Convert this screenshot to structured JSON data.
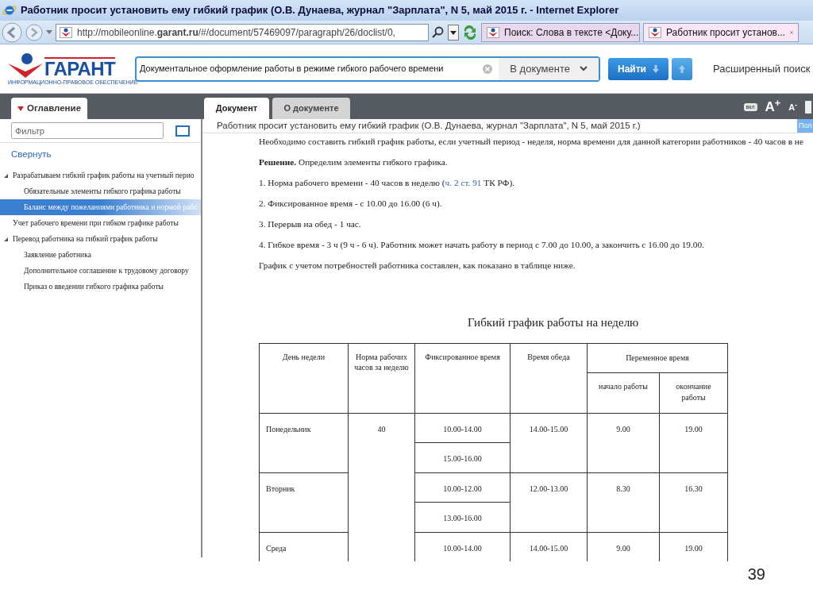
{
  "window": {
    "title": "Работник просит установить ему гибкий график (О.В. Дунаева, журнал \"Зарплата\", N 5, май 2015 г. - Internet Explorer"
  },
  "address_bar": {
    "url": "http://mobileonline.**garant.ru**/#/document/57469097/paragraph/26/doclist/0,"
  },
  "browser_tabs": [
    {
      "label": "Поиск: Слова в тексте <Доку...",
      "selected": false
    },
    {
      "label": "Работник просит установ...",
      "selected": true
    }
  ],
  "logo": {
    "name": "ГАРАНТ",
    "tagline": "ИНФОРМАЦИОННО-ПРАВОВОЕ ОБЕСПЕЧЕНИЕ"
  },
  "search": {
    "value": "Документальное оформление работы в режиме гибкого рабочего времени",
    "scope": "В документе",
    "button": "Найти",
    "advanced": "Расширенный поиск"
  },
  "toc": {
    "tab": "Оглавление",
    "filter_placeholder": "Фильтр",
    "collapse": "Свернуть",
    "items": [
      {
        "label": "Разрабатываем гибкий график работы на учетный перио",
        "expanded": true,
        "selected": false,
        "children": [
          {
            "label": "Обязательные элементы гибкого графика работы",
            "selected": false
          },
          {
            "label": "Баланс между пожеланиями работника и нормой рабо",
            "selected": true
          }
        ]
      },
      {
        "label": "Учет рабочего времени при гибком графике работы",
        "selected": false
      },
      {
        "label": "Перевод работника на гибкий график работы",
        "expanded": true,
        "selected": false,
        "children": [
          {
            "label": "Заявление работника",
            "selected": false
          },
          {
            "label": "Дополнительное соглашение к трудовому договору",
            "selected": false
          },
          {
            "label": "Приказ о введении гибкого графика работы",
            "selected": false
          }
        ]
      }
    ]
  },
  "doc_tabs": [
    {
      "label": "Документ",
      "selected": true
    },
    {
      "label": "О документе",
      "selected": false
    }
  ],
  "toolbar": {
    "toggle": "вкл",
    "font_larger": "A$^{+}$",
    "font_smaller": "A$^{-}$"
  },
  "document": {
    "title": "Работник просит установить ему гибкий график (О.В. Дунаева, журнал \"Зарплата\", N 5, май 2015 г.)",
    "side_button": "Пол",
    "paragraphs": [
      [
        {
          "kind": "text",
          "text": "Необходимо составить гибкий график работы, если учетный период - неделя, норма времени для данной категории работников - 40 часов в не"
        }
      ],
      [
        {
          "kind": "text",
          "text": "**Решение.** Определим элементы гибкого графика."
        }
      ],
      [
        {
          "kind": "text",
          "text": "1. Норма рабочего времени - 40 часов в неделю ("
        },
        {
          "kind": "link",
          "text": "ч. 2 ст. 91"
        },
        {
          "kind": "text",
          "text": " ТК РФ)."
        }
      ],
      [
        {
          "kind": "text",
          "text": "2. Фиксированное время - с 10.00 до 16.00 (6 ч)."
        }
      ],
      [
        {
          "kind": "text",
          "text": "3. Перерыв на обед - 1 час."
        }
      ],
      [
        {
          "kind": "text",
          "text": "4. Гибкое время - 3 ч (9 ч - 6 ч). Работник может начать работу в период с 7.00 до 10.00, а закончить с 16.00 до 19.00."
        }
      ],
      [
        {
          "kind": "text",
          "text": "График с учетом потребностей работника составлен, как показано в таблице ниже."
        }
      ]
    ],
    "table": {
      "title": "Гибкий график работы на неделю",
      "columns": [
        "День недели",
        "Норма рабочих часов за неделю",
        "Фиксированное время",
        "Время обеда"
      ],
      "group_column": "Переменное время",
      "sub_columns": [
        "начало работы",
        "окончание работы"
      ],
      "norm": "40",
      "rows": [
        {
          "day": "Понедельник",
          "fixed": [
            "10.00-14.00",
            "15.00-16.00"
          ],
          "lunch": "14.00-15.00",
          "start": "9.00",
          "end": "19.00"
        },
        {
          "day": "Вторник",
          "fixed": [
            "10.00-12.00",
            "13.00-16.00"
          ],
          "lunch": "12.00-13.00",
          "start": "8.30",
          "end": "16.30"
        },
        {
          "day": "Среда",
          "fixed": [
            "10.00-14.00"
          ],
          "lunch": "14.00-15.00",
          "start": "9.00",
          "end": "19.00"
        }
      ]
    }
  },
  "slide_number": "39"
}
